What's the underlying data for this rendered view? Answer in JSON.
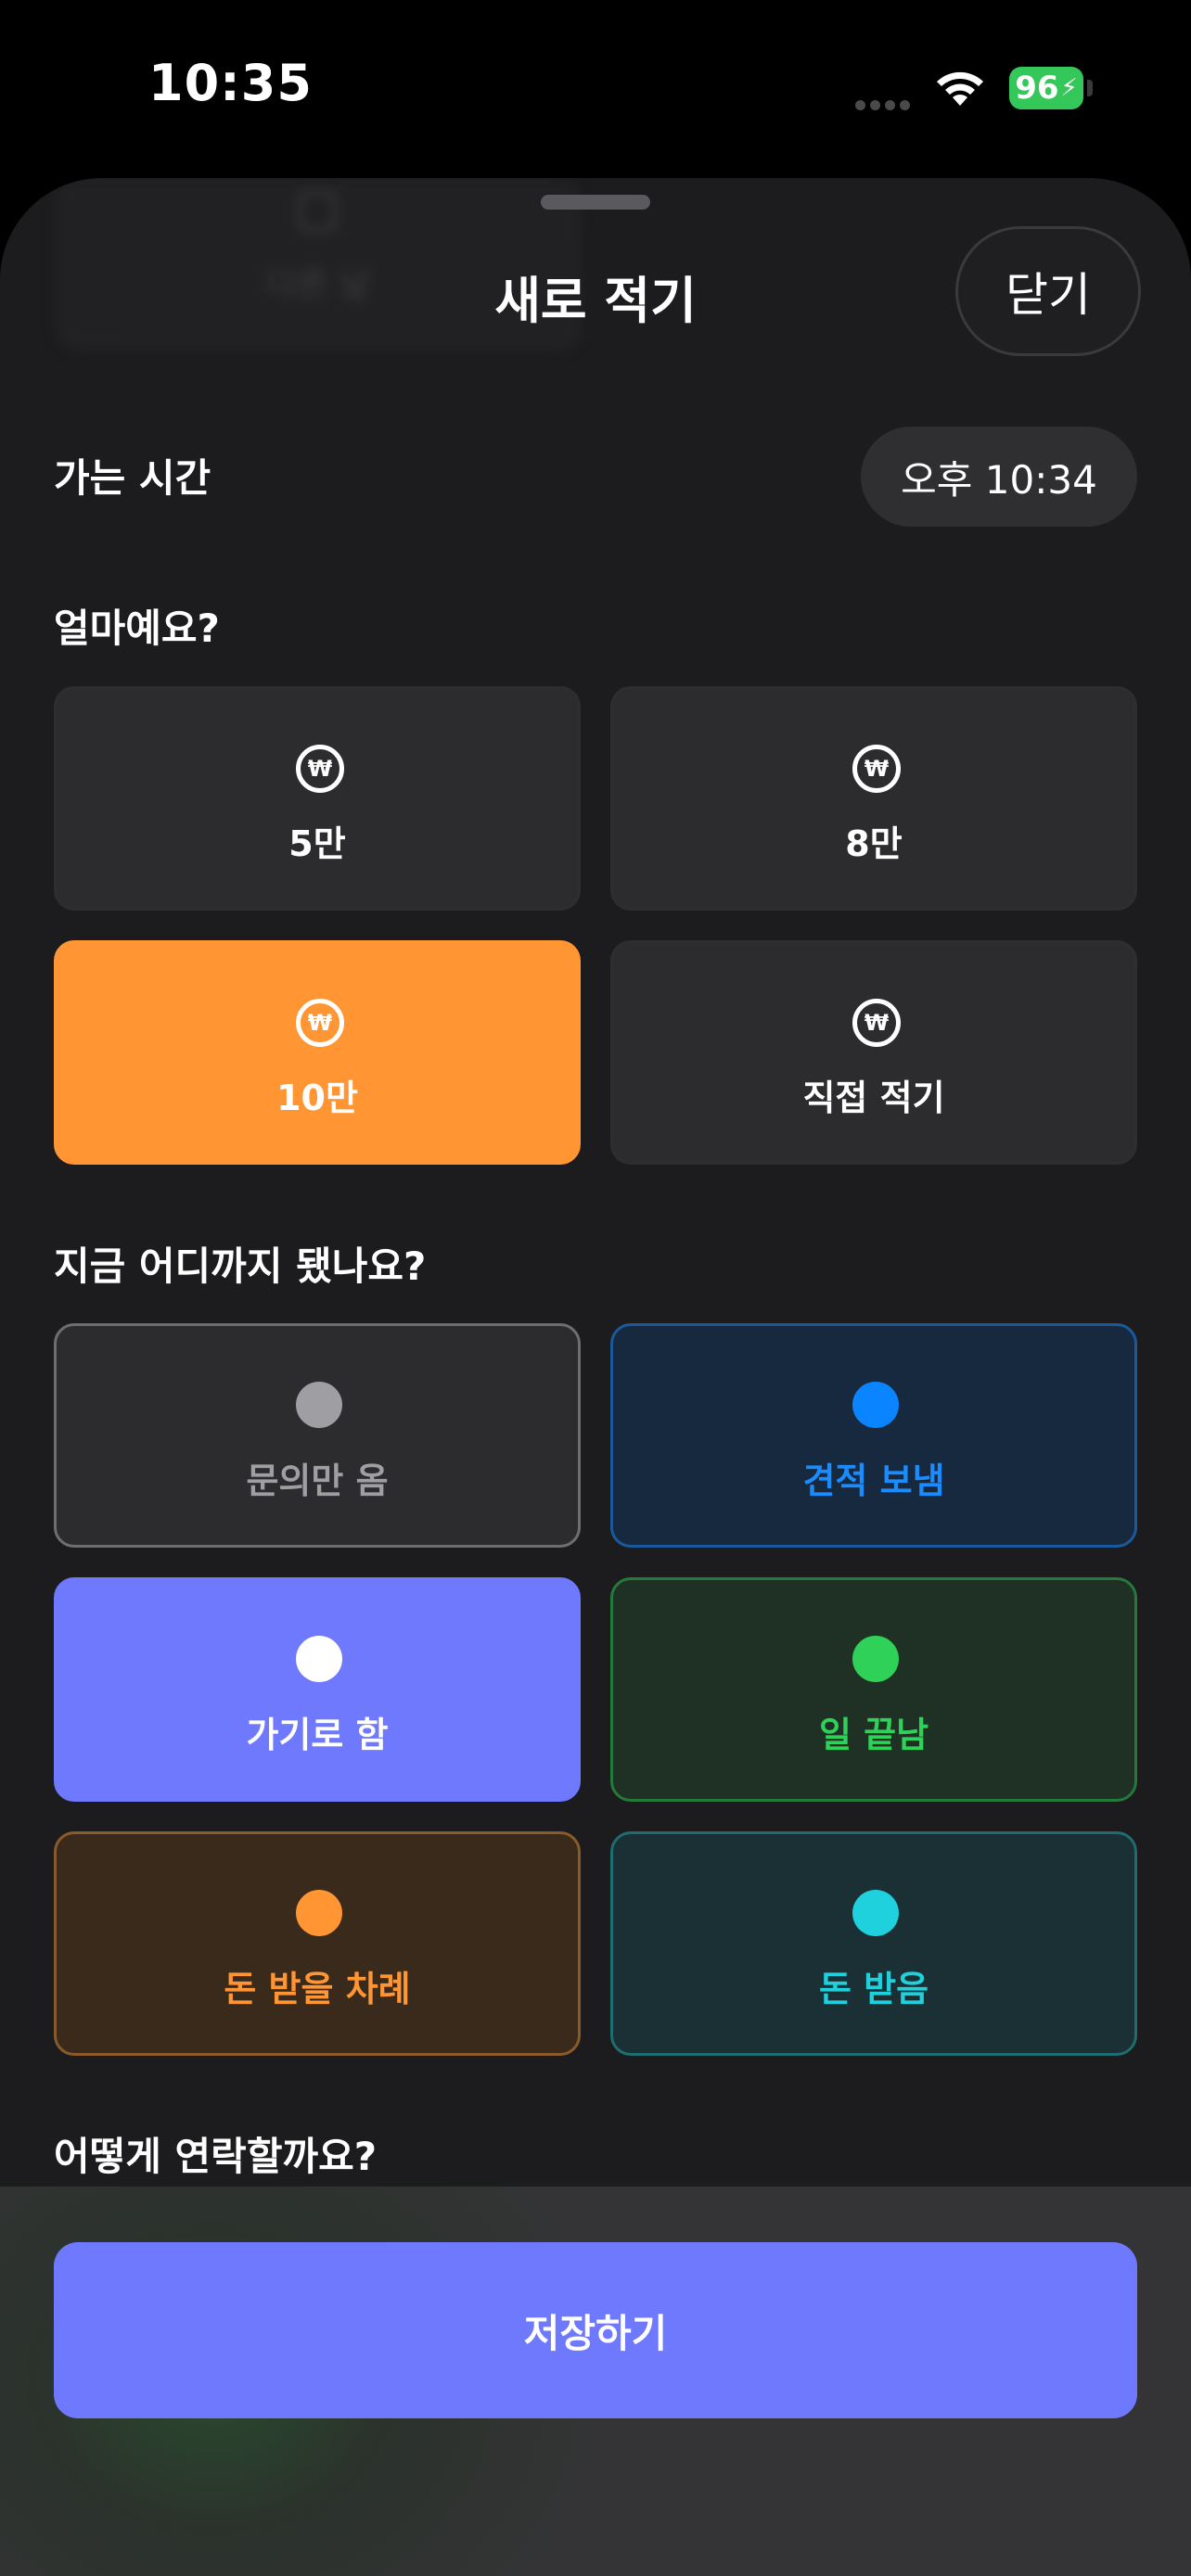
{
  "status_bar": {
    "time": "10:35",
    "battery": "96"
  },
  "sheet": {
    "title": "새로 적기",
    "close_label": "닫기",
    "background_card_label": "다른 날"
  },
  "departure": {
    "label": "가는 시간",
    "value": "오후 10:34"
  },
  "amount": {
    "label": "얼마예요?",
    "currency_symbol": "₩",
    "options": [
      {
        "label": "5만",
        "selected": false
      },
      {
        "label": "8만",
        "selected": false
      },
      {
        "label": "10만",
        "selected": true
      },
      {
        "label": "직접 적기",
        "selected": false
      }
    ]
  },
  "progress": {
    "label": "지금 어디까지 됐나요?",
    "options": [
      {
        "label": "문의만 옴",
        "color": "#9e9ea3"
      },
      {
        "label": "견적 보냄",
        "color": "#0a84ff"
      },
      {
        "label": "가기로 함",
        "color": "#ffffff",
        "selected": true
      },
      {
        "label": "일 끝남",
        "color": "#30d158"
      },
      {
        "label": "돈 받을 차례",
        "color": "#ff9533"
      },
      {
        "label": "돈 받음",
        "color": "#1ed1dd"
      }
    ]
  },
  "contact": {
    "label": "어떻게 연락할까요?"
  },
  "footer": {
    "save_label": "저장하기"
  },
  "colors": {
    "accent": "#6e79fe",
    "amount_selected": "#ff9533"
  }
}
